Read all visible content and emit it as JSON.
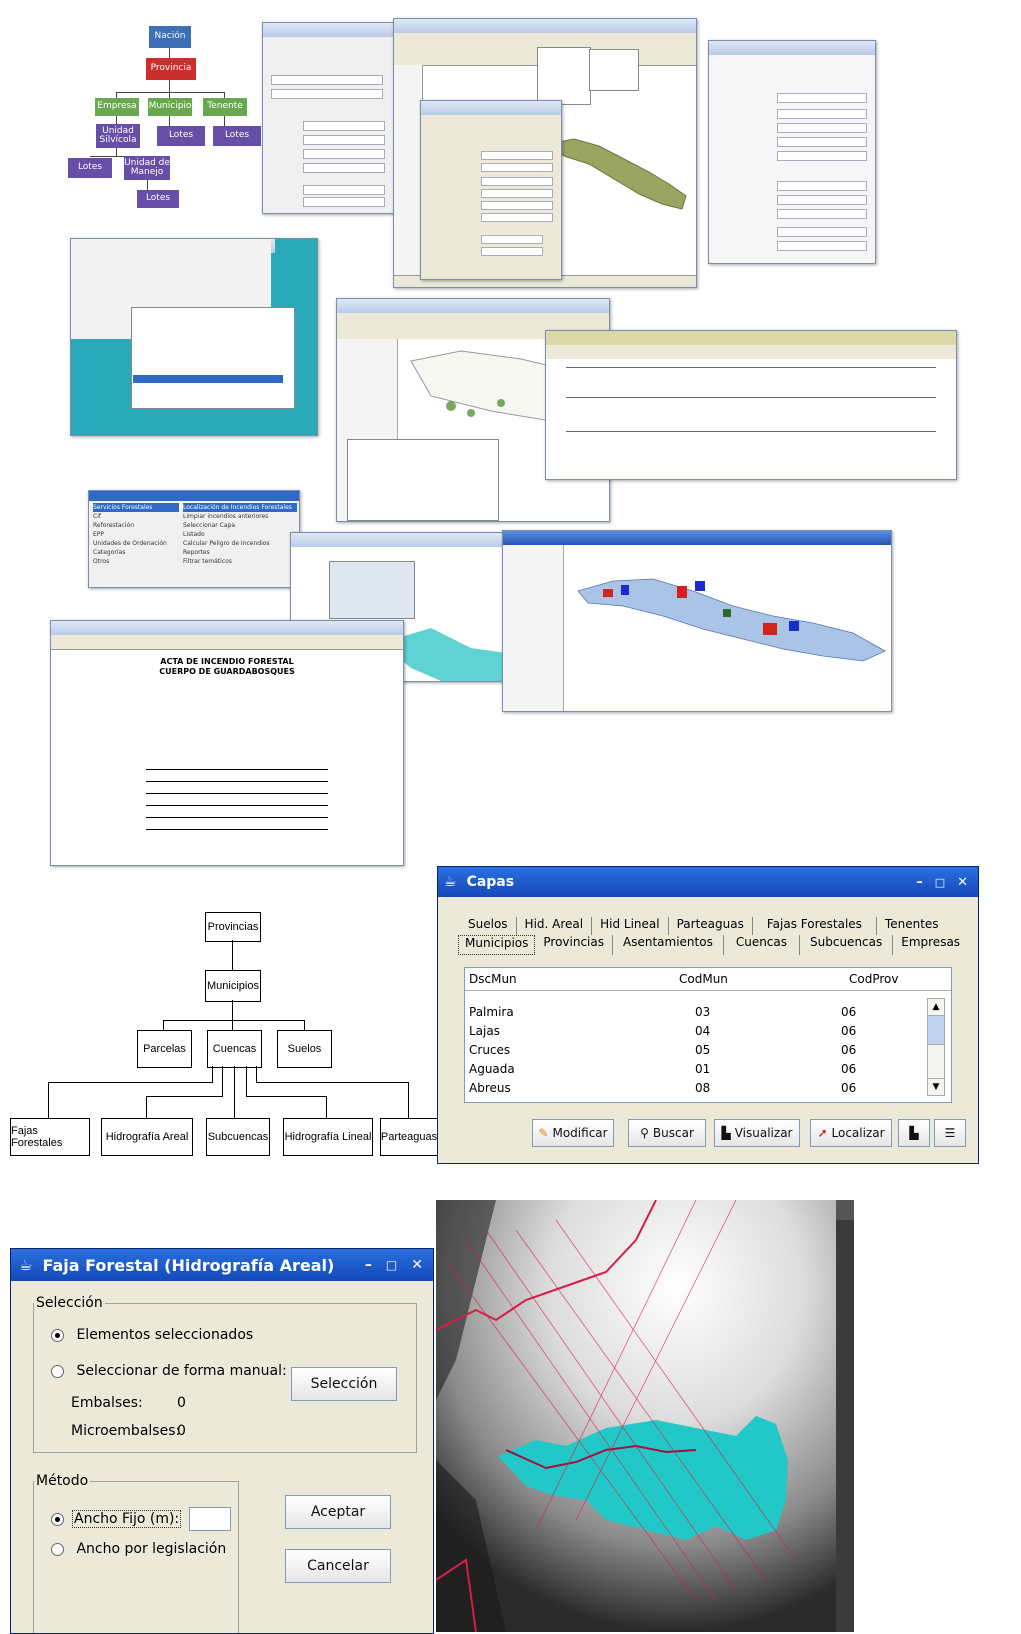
{
  "org_chart": {
    "nacion": "Nación",
    "provincia": "Provincia",
    "empresa": "Empresa",
    "municipio": "Municipio",
    "tenente": "Tenente",
    "unidad_silvicola": "Unidad Silvícola",
    "lotes_a": "Lotes",
    "lotes_b": "Lotes",
    "lotes_c": "Lotes",
    "unidad_manejo": "Unidad de Manejo",
    "lotes_d": "Lotes"
  },
  "menu_shot": {
    "items": [
      "Servicios Forestales",
      "Cif",
      "Reforestación",
      "EPP",
      "Unidades de Ordenación",
      "Categorías",
      "Otros"
    ],
    "submenu": [
      "Localización de Incendios Forestales",
      "Limpiar incendios anteriores",
      "Seleccionar Capa",
      "Listado",
      "Calcular Peligro de Incendios",
      "Reportes",
      "Filtrar temáticos"
    ]
  },
  "acta": {
    "title": "ACTA DE INCENDIO FORESTAL",
    "subtitle": "CUERPO DE GUARDABOSQUES"
  },
  "capas": {
    "title": "Capas",
    "tabs_row1": [
      "Suelos",
      "Hid. Areal",
      "Hid Lineal",
      "Parteaguas",
      "Fajas Forestales",
      "Tenentes"
    ],
    "tabs_row2": [
      "Municipios",
      "Provincias",
      "Asentamientos",
      "Cuencas",
      "Subcuencas",
      "Empresas"
    ],
    "columns": [
      "DscMun",
      "CodMun",
      "CodProv"
    ],
    "rows": [
      [
        "Palmira",
        "03",
        "06"
      ],
      [
        "Lajas",
        "04",
        "06"
      ],
      [
        "Cruces",
        "05",
        "06"
      ],
      [
        "Aguada",
        "01",
        "06"
      ],
      [
        "Abreus",
        "08",
        "06"
      ]
    ],
    "buttons": {
      "modificar": "Modificar",
      "buscar": "Buscar",
      "visualizar": "Visualizar",
      "localizar": "Localizar"
    }
  },
  "hierarchy": {
    "provincias": "Provincias",
    "municipios": "Municipios",
    "parcelas": "Parcelas",
    "cuencas": "Cuencas",
    "suelos": "Suelos",
    "fajas": "Fajas Forestales",
    "hid_areal": "Hidrografía Areal",
    "subcuencas": "Subcuencas",
    "hid_lineal": "Hidrografía Lineal",
    "parteaguas": "Parteaguas"
  },
  "faja": {
    "title": "Faja Forestal (Hidrografía Areal)",
    "seleccion_legend": "Selección",
    "opt_elementos": "Elementos seleccionados",
    "opt_manual": "Seleccionar de forma manual:",
    "btn_seleccion": "Selección",
    "embalses_label": "Embalses:",
    "embalses_value": "0",
    "micro_label": "Microembalses:",
    "micro_value": "0",
    "metodo_legend": "Método",
    "opt_ancho_fijo": "Ancho Fijo (m):",
    "opt_ancho_leg": "Ancho por legislación",
    "btn_aceptar": "Aceptar",
    "btn_cancelar": "Cancelar"
  },
  "colors": {
    "title_blue": "#1d5fd0",
    "cyan_area": "#22c8c8",
    "river_red": "#d41e4a"
  }
}
